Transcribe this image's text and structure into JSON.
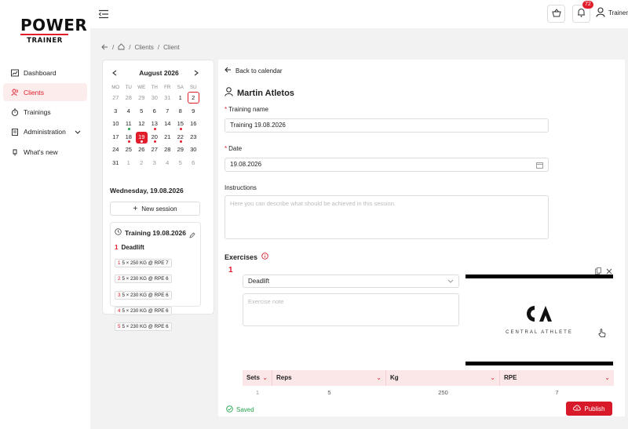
{
  "brand": {
    "top": "POWER",
    "bottom": "TRAINER"
  },
  "sidebar": {
    "items": [
      {
        "label": "Dashboard",
        "icon": "chart-icon"
      },
      {
        "label": "Clients",
        "icon": "users-icon"
      },
      {
        "label": "Trainings",
        "icon": "stopwatch-icon"
      },
      {
        "label": "Administration",
        "icon": "clipboard-icon"
      },
      {
        "label": "What's new",
        "icon": "megaphone-icon"
      }
    ],
    "active": "Clients"
  },
  "topbar": {
    "notifications": "72",
    "user": "Trainer"
  },
  "breadcrumb": {
    "items": [
      "Clients",
      "Client"
    ]
  },
  "calendar": {
    "title": "August 2026",
    "dows": [
      "MO",
      "TU",
      "WE",
      "TH",
      "FR",
      "SA",
      "SU"
    ],
    "weeks": [
      [
        {
          "d": "27",
          "m": 1
        },
        {
          "d": "28",
          "m": 1
        },
        {
          "d": "29",
          "m": 1
        },
        {
          "d": "30",
          "m": 1
        },
        {
          "d": "31",
          "m": 1
        },
        {
          "d": "1"
        },
        {
          "d": "2",
          "today": 1
        }
      ],
      [
        {
          "d": "3"
        },
        {
          "d": "4"
        },
        {
          "d": "5"
        },
        {
          "d": "6"
        },
        {
          "d": "7"
        },
        {
          "d": "8"
        },
        {
          "d": "9"
        }
      ],
      [
        {
          "d": "10"
        },
        {
          "d": "11",
          "dot": "#22a34a"
        },
        {
          "d": "12"
        },
        {
          "d": "13",
          "dot": "#e11d2c"
        },
        {
          "d": "14"
        },
        {
          "d": "15",
          "dot": "#e11d2c"
        },
        {
          "d": "16"
        }
      ],
      [
        {
          "d": "17"
        },
        {
          "d": "18",
          "dot": "#e11d2c"
        },
        {
          "d": "19",
          "sel": 1,
          "dot": "#ffffff"
        },
        {
          "d": "20",
          "dot": "#e11d2c"
        },
        {
          "d": "21"
        },
        {
          "d": "22",
          "dot": "#e11d2c"
        },
        {
          "d": "23"
        }
      ],
      [
        {
          "d": "24"
        },
        {
          "d": "25"
        },
        {
          "d": "26"
        },
        {
          "d": "27"
        },
        {
          "d": "28"
        },
        {
          "d": "29"
        },
        {
          "d": "30"
        }
      ],
      [
        {
          "d": "31"
        },
        {
          "d": "1",
          "m": 1
        },
        {
          "d": "2",
          "m": 1
        },
        {
          "d": "3",
          "m": 1
        },
        {
          "d": "4",
          "m": 1
        },
        {
          "d": "5",
          "m": 1
        },
        {
          "d": "6",
          "m": 1
        }
      ]
    ],
    "selected_date": "Wednesday, 19.08.2026",
    "new_session": "New session",
    "session": {
      "title": "Training 19.08.2026",
      "exercise_num": "1",
      "exercise": "Deadlift",
      "sets": [
        {
          "n": "1",
          "text": "5 × 250 KG @ RPE 7"
        },
        {
          "n": "2",
          "text": "5 × 230 KG @ RPE 6"
        },
        {
          "n": "3",
          "text": "5 × 230 KG @ RPE 6"
        },
        {
          "n": "4",
          "text": "5 × 230 KG @ RPE 6"
        },
        {
          "n": "5",
          "text": "5 × 230 KG @ RPE 6"
        }
      ]
    }
  },
  "form": {
    "back": "Back to calendar",
    "client": "Martin Atletos",
    "training_name_label": "Training name",
    "training_name_value": "Training 19.08.2026",
    "date_label": "Date",
    "date_value": "19.08.2026",
    "instructions_label": "Instructions",
    "instructions_placeholder": "Here you can describe what should be achieved in this session.",
    "exercises_label": "Exercises",
    "exercise_num": "1",
    "exercise_value": "Deadlift",
    "exercise_note_placeholder": "Exercise note",
    "video_brand": "CENTRAL ATHLETE",
    "table_headers": [
      "Sets",
      "Reps",
      "Kg",
      "RPE"
    ],
    "table_row": [
      "1",
      "5",
      "250",
      "7"
    ],
    "saved": "Saved",
    "publish": "Publish"
  },
  "colors": {
    "accent": "#e11d2c",
    "success": "#22a34a",
    "bg": "#f2f2f3"
  }
}
